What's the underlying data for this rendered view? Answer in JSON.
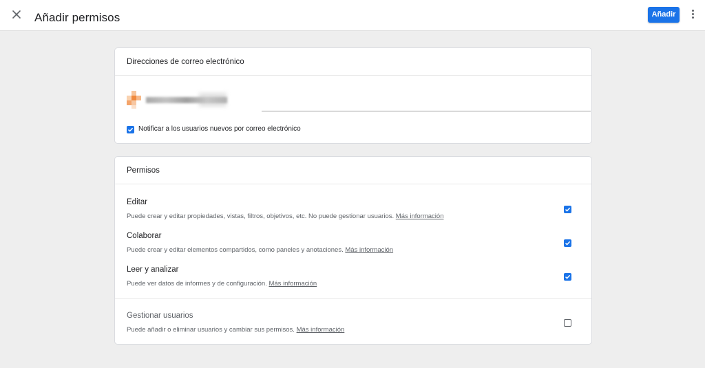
{
  "header": {
    "title": "Añadir permisos",
    "add_button_label": "Añadir",
    "close_icon": "close-icon",
    "more_icon": "more-vert-icon"
  },
  "email_card": {
    "title": "Direcciones de correo electrónico",
    "notify_checked": true,
    "notify_label": "Notificar a los usuarios nuevos por correo electrónico"
  },
  "permissions_card": {
    "title": "Permisos",
    "items": [
      {
        "title": "Editar",
        "description": "Puede crear y editar propiedades, vistas, filtros, objetivos, etc. No puede gestionar usuarios.",
        "link": "Más información",
        "checked": true
      },
      {
        "title": "Colaborar",
        "description": "Puede crear y editar elementos compartidos, como paneles y anotaciones.",
        "link": "Más información",
        "checked": true
      },
      {
        "title": "Leer y analizar",
        "description": "Puede ver datos de informes y de configuración.",
        "link": "Más información",
        "checked": true
      },
      {
        "title": "Gestionar usuarios",
        "description": "Puede añadir o eliminar usuarios y cambiar sus permisos.",
        "link": "Más información",
        "checked": false
      }
    ]
  },
  "colors": {
    "accent": "#1a73e8",
    "background": "#eeeeee",
    "card": "#ffffff"
  }
}
